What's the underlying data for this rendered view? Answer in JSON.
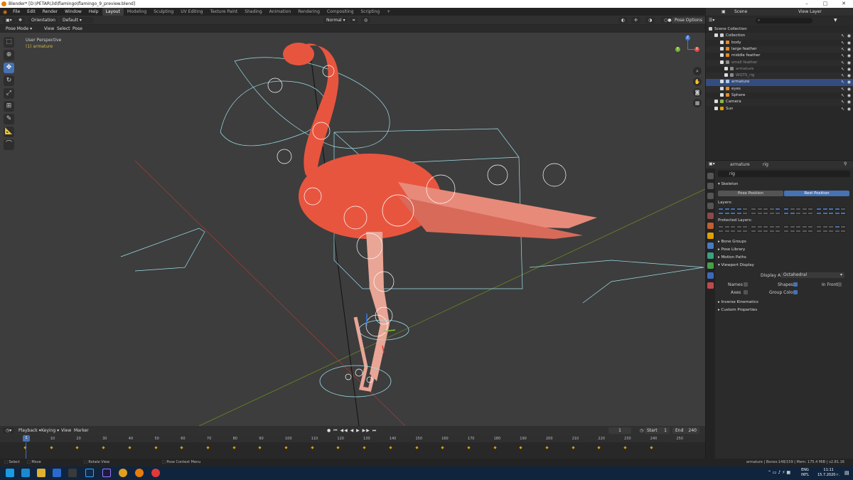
{
  "window": {
    "title": "Blender* [D:\\PETAR\\3d\\flamingo\\flamingo_9_preview.blend]"
  },
  "menus": [
    "File",
    "Edit",
    "Render",
    "Window",
    "Help"
  ],
  "workspaces": [
    "Layout",
    "Modeling",
    "Sculpting",
    "UV Editing",
    "Texture Paint",
    "Shading",
    "Animation",
    "Rendering",
    "Compositing",
    "Scripting"
  ],
  "scene": {
    "label": "Scene",
    "view_layer": "View Layer"
  },
  "viewport_header": {
    "orientation_label": "Orientation",
    "orientation_value": "Default",
    "pivot": "Normal",
    "mode": "Pose Mode",
    "menus": [
      "View",
      "Select",
      "Pose"
    ],
    "pose_options": "Pose Options"
  },
  "viewport_info": {
    "line1": "User Perspective",
    "line2": "(1) armature"
  },
  "gizmo": {
    "x": "X",
    "y": "Y",
    "z": "Z"
  },
  "outliner": {
    "rows": [
      {
        "label": "Scene Collection",
        "color": "#cccccc",
        "style": "normal"
      },
      {
        "label": "Collection",
        "color": "#cccccc",
        "style": "normal"
      },
      {
        "label": "body",
        "color": "#e38b27",
        "style": "normal"
      },
      {
        "label": "large feather",
        "color": "#e38b27",
        "style": "normal"
      },
      {
        "label": "middle feather",
        "color": "#e38b27",
        "style": "normal"
      },
      {
        "label": "small feather",
        "color": "#8a8a8a",
        "style": "dim"
      },
      {
        "label": "armature",
        "color": "#8a8a8a",
        "style": "dim"
      },
      {
        "label": "WGTS_rig",
        "color": "#8a8a8a",
        "style": "dim"
      },
      {
        "label": "armature",
        "color": "#aac8e8",
        "style": "sel"
      },
      {
        "label": "eyes",
        "color": "#e38b27",
        "style": "normal"
      },
      {
        "label": "Sphere",
        "color": "#e38b27",
        "style": "normal"
      },
      {
        "label": "Camera",
        "color": "#8fb44a",
        "style": "normal"
      },
      {
        "label": "Sun",
        "color": "#e0a000",
        "style": "normal"
      }
    ]
  },
  "properties": {
    "object_name": "armature",
    "data_name": "rig",
    "field": "rig",
    "skeleton": "Skeleton",
    "pose_position": "Pose Position",
    "rest_position": "Rest Position",
    "layers": "Layers:",
    "protected_layers": "Protected Layers:",
    "sections": [
      "Bone Groups",
      "Pose Library",
      "Motion Paths",
      "Viewport Display"
    ],
    "display_as_label": "Display As",
    "display_as_value": "Octahedral",
    "names": "Names",
    "axes": "Axes",
    "shapes": "Shapes",
    "group_colors": "Group Colors",
    "in_front": "In Front",
    "sections2": [
      "Inverse Kinematics",
      "Custom Properties"
    ]
  },
  "timeline": {
    "menus": [
      "Playback",
      "Keying",
      "View",
      "Marker"
    ],
    "current_frame": "1",
    "start_label": "Start",
    "start": "1",
    "end_label": "End",
    "end": "240",
    "ticks": [
      "1",
      "10",
      "20",
      "30",
      "40",
      "50",
      "60",
      "70",
      "80",
      "90",
      "100",
      "110",
      "120",
      "130",
      "140",
      "150",
      "160",
      "170",
      "180",
      "190",
      "200",
      "210",
      "220",
      "230",
      "240",
      "250"
    ]
  },
  "statusbar": {
    "left": [
      "Select",
      "Move",
      "Rotate View",
      "Pose Context Menu"
    ],
    "right": "armature | Bones:148/159 | Mem: 175.4 MiB | v2.81.16"
  },
  "taskbar": {
    "lang1": "ENG",
    "lang2": "INTL",
    "time": "11:11",
    "date": "15.7.2020 г."
  },
  "colors": {
    "accent": "#4772b3",
    "header": "#303030",
    "viewport": "#3d3d3d",
    "flamingo": "#e8553f",
    "bone": "#9ee0ea"
  }
}
